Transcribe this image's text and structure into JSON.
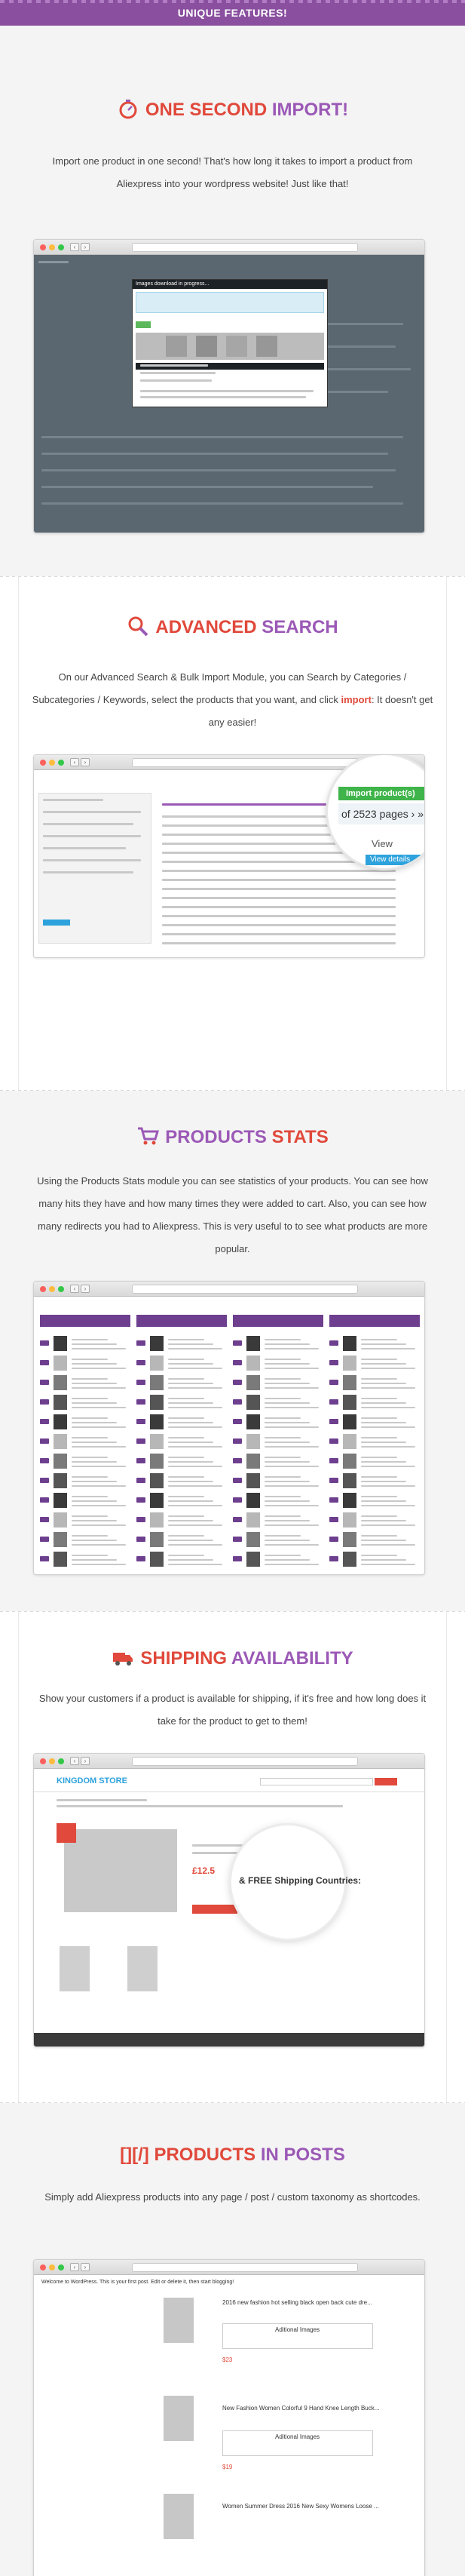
{
  "banner": {
    "title": "UNIQUE FEATURES!"
  },
  "sections": {
    "import": {
      "title_part1": "ONE SECOND",
      "title_part2": "IMPORT!",
      "description": "Import one product in one second! That's how long it takes to import a product from Aliexpress into your wordpress website! Just like that!",
      "icon": "stopwatch-icon",
      "screenshot": {
        "modal_title": "Images download in progress..."
      }
    },
    "search": {
      "title_part1": "ADVANCED",
      "title_part2": "SEARCH",
      "description_before": "On our Advanced Search & Bulk Import Module, you can Search by Categories / Subcategories / Keywords, select the products that you want, and click ",
      "description_highlight": "import",
      "description_after": ": It doesn't get any easier!",
      "icon": "magnifier-icon",
      "screenshot": {
        "button_label": "Import product(s)",
        "pages_label": "of 2523 pages",
        "view_label": "View",
        "details_label": "View details"
      }
    },
    "stats": {
      "title_part1": "PRODUCTS",
      "title_part2": "STATS",
      "description": "Using the Products Stats module you can see statistics of your products. You can see how many hits they have and how many times they were added to cart. Also, you can see how many redirects you had to Aliexpress. This is very useful to to see what products are more popular.",
      "icon": "cart-icon"
    },
    "shipping": {
      "title_part1": "SHIPPING",
      "title_part2": "AVAILABILITY",
      "description": "Show your customers if a product is available for shipping, if it's free and how long does it take for the product to get to them!",
      "icon": "truck-icon",
      "screenshot": {
        "store_name": "KINGDOM STORE",
        "magnifier_text": "& FREE Shipping Countries:",
        "price": "£12.5"
      }
    },
    "posts": {
      "title_part1": "[][/] PRODUCTS",
      "title_part2": "IN POSTS",
      "description": "Simply add Aliexpress products into any page / post / custom taxonomy as shortcodes.",
      "screenshot": {
        "welcome": "Welcome to WordPress. This is your first post. Edit or delete it, then start blogging!",
        "items": [
          {
            "title": "2016 new fashion hot selling black open back cute dre...",
            "images_label": "Aditional Images",
            "price": "$23"
          },
          {
            "title": "New Fashion Women Colorful 9 Hand Knee Length Buck...",
            "images_label": "Aditional Images",
            "price": "$19"
          },
          {
            "title": "Women Summer Dress 2016 New Sexy Womens Loose ...",
            "images_label": "",
            "price": ""
          }
        ]
      }
    }
  },
  "colors": {
    "brand_purple": "#8a4f9f",
    "accent_red": "#e0493b",
    "title_purple": "#9b59b6"
  }
}
